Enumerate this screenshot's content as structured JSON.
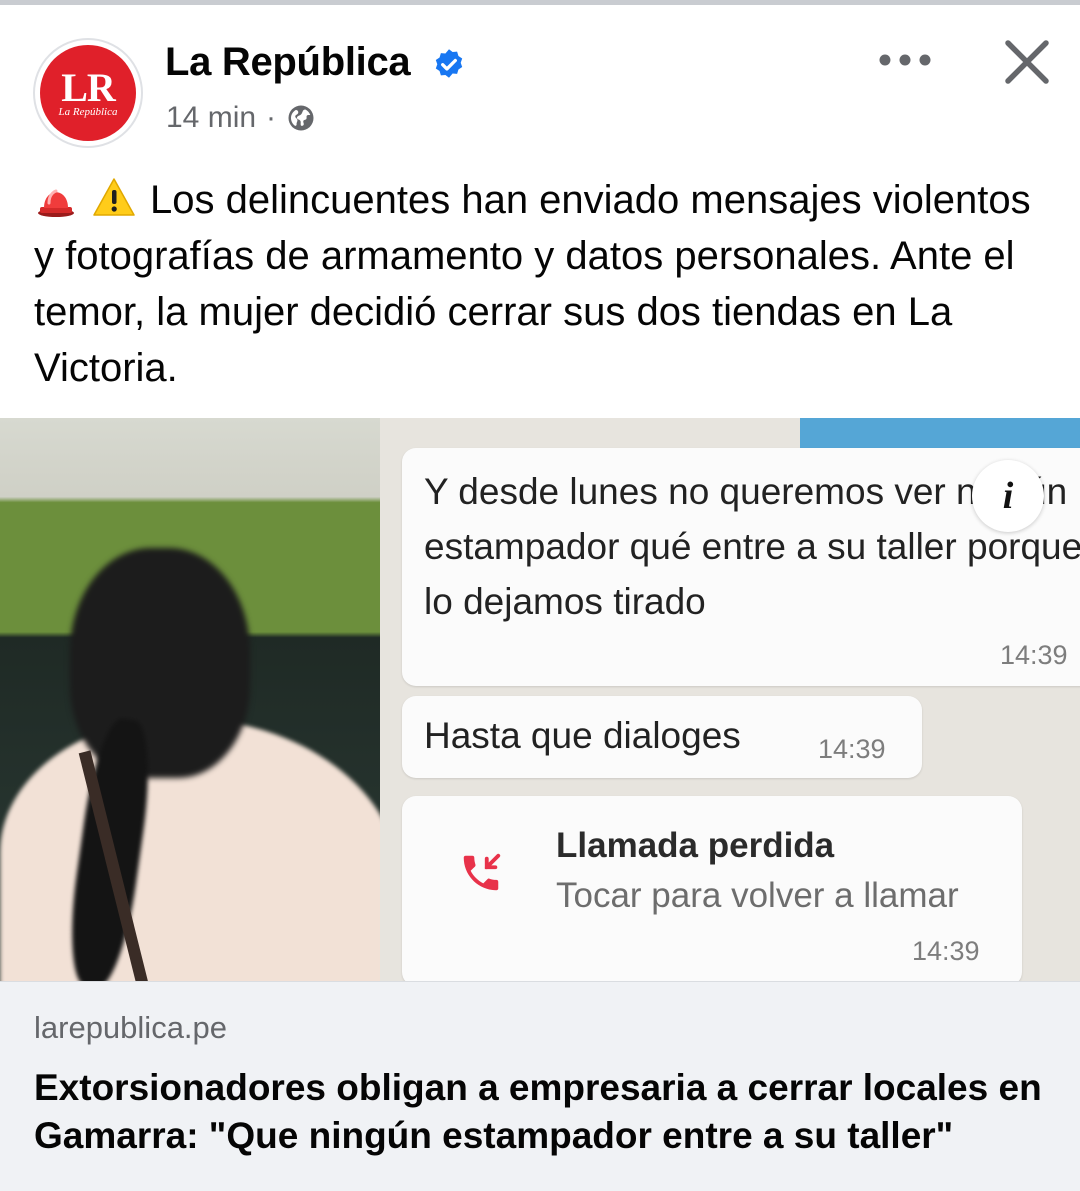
{
  "post": {
    "page_name": "La República",
    "time": "14 min",
    "separator": "·",
    "visibility_icon": "globe-icon",
    "verified_icon": "verified-badge-icon",
    "avatar": {
      "letters": "LR",
      "subtitle": "La República"
    },
    "more_icon": "more-options-icon",
    "close_icon": "close-icon",
    "text": "Los delincuentes han enviado mensajes violentos y fotografías de armamento y datos personales. Ante el temor, la mujer decidió cerrar sus dos tiendas en La Victoria.",
    "emojis": [
      "police-light-emoji",
      "warning-emoji"
    ]
  },
  "media": {
    "messages": [
      {
        "text": "Y desde lunes no queremos ver ningún estampador qué entre a su taller porque lo dejamos tirado",
        "time": "14:39"
      },
      {
        "text": "Hasta que dialoges",
        "time": "14:39"
      }
    ],
    "missed_call": {
      "title": "Llamada perdida",
      "subtitle": "Tocar para volver a llamar",
      "time": "14:39"
    },
    "info_label": "i"
  },
  "link": {
    "domain": "larepublica.pe",
    "title": "Extorsionadores obligan a empresaria a cerrar locales en Gamarra: \"Que ningún estampador entre a su taller\""
  },
  "colors": {
    "brand_red": "#e0202a",
    "verified_blue": "#1877f2",
    "missed_call_red": "#e8324a",
    "link_bg": "#f0f2f5"
  }
}
